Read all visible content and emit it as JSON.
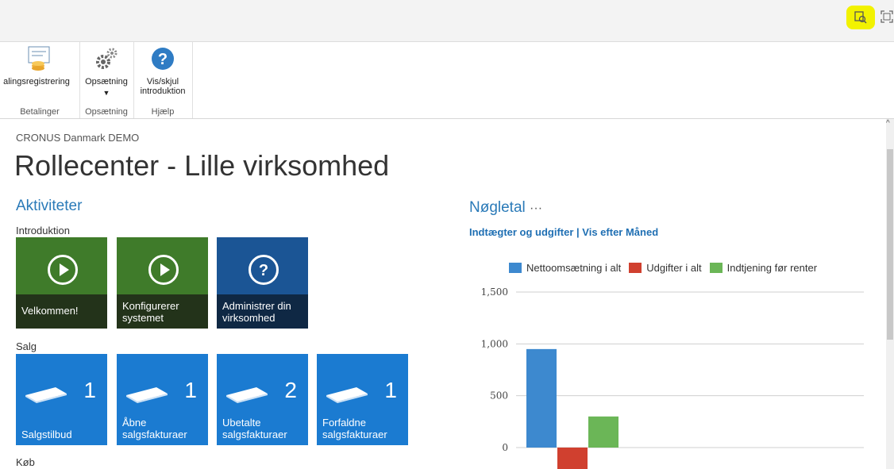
{
  "toolbar": {
    "icons": [
      "copy-search-icon",
      "fullscreen-icon"
    ],
    "highlight_color": "#f2f200"
  },
  "ribbon": {
    "buttons": [
      {
        "label": "alingsregistrering",
        "group": "Betalinger"
      },
      {
        "label": "Opsætning",
        "group": "Opsætning"
      },
      {
        "label_line1": "Vis/skjul",
        "label_line2": "introduktion",
        "group": "Hjælp"
      }
    ],
    "groups": [
      "Betalinger",
      "Opsætning",
      "Hjælp"
    ]
  },
  "page": {
    "company": "CRONUS Danmark DEMO",
    "title": "Rollecenter - Lille virksomhed"
  },
  "activities": {
    "heading": "Aktiviteter",
    "intro_heading": "Introduktion",
    "intro_tiles": [
      {
        "label": "Velkommen!",
        "icon": "play-icon"
      },
      {
        "label_line1": "Konfigurerer",
        "label_line2": "systemet",
        "icon": "play-icon"
      },
      {
        "label_line1": "Administrer din",
        "label_line2": "virksomhed",
        "icon": "help-icon"
      }
    ],
    "sales_heading": "Salg",
    "sales_tiles": [
      {
        "label_line1": "Salgstilbud",
        "label_line2": "",
        "count": "1"
      },
      {
        "label_line1": "Åbne",
        "label_line2": "salgsfakturaer",
        "count": "1"
      },
      {
        "label_line1": "Ubetalte",
        "label_line2": "salgsfakturaer",
        "count": "2"
      },
      {
        "label_line1": "Forfaldne",
        "label_line2": "salgsfakturaer",
        "count": "1"
      }
    ],
    "purchase_heading": "Køb"
  },
  "kpi": {
    "heading": "Nøgletal",
    "more": "···",
    "link": "Indtægter og udgifter | Vis efter Måned"
  },
  "chart_data": {
    "type": "bar",
    "categories": [
      ""
    ],
    "series": [
      {
        "name": "Nettoomsætning i alt",
        "color": "#3d89cf",
        "values": [
          950
        ]
      },
      {
        "name": "Udgifter i alt",
        "color": "#d0402f",
        "values": [
          -420
        ]
      },
      {
        "name": "Indtjening før renter",
        "color": "#6bb657",
        "values": [
          300
        ]
      }
    ],
    "ylim": [
      0,
      1500
    ],
    "yticks": [
      "1,500",
      "1,000",
      "500",
      "0"
    ],
    "legend": "top"
  }
}
